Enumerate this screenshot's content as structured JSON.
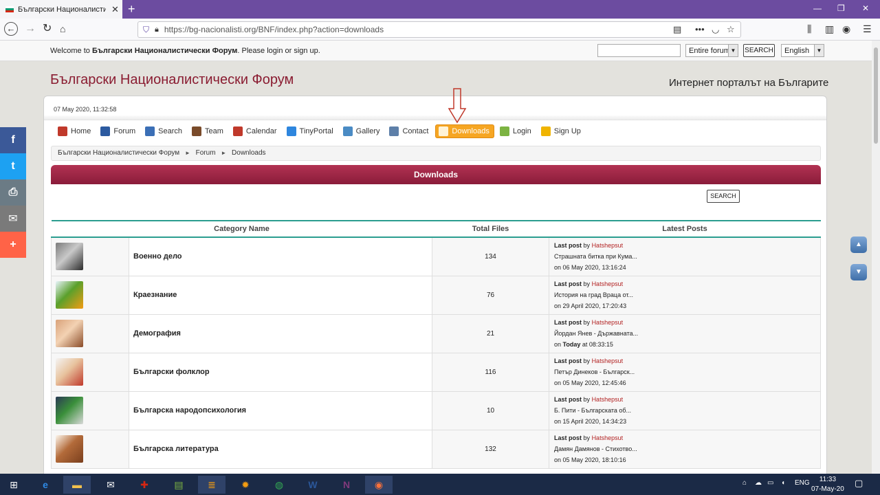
{
  "browser": {
    "tab_title": "Български Националисти...",
    "tab_close": "✕",
    "new_tab": "+",
    "url": "https://bg-nacionalisti.org/BNF/index.php?action=downloads",
    "window_controls": [
      "—",
      "❐",
      "✕"
    ]
  },
  "topbar": {
    "welcome_prefix": "Welcome to ",
    "forum_name": "Български Националистически Форум",
    "welcome_suffix": ". Please login or sign up.",
    "scope_select": "Entire forum",
    "search_button": "SEARCH",
    "language_select": "English"
  },
  "header": {
    "site_title": "Български Националистически Форум",
    "tagline": "Интернет порталът на Българите"
  },
  "datetime": "07 May 2020, 11:32:58",
  "menu": [
    {
      "label": "Home",
      "icon": "home-icon",
      "color": "#c0392b"
    },
    {
      "label": "Forum",
      "icon": "forum-icon",
      "color": "#2c5aa0"
    },
    {
      "label": "Search",
      "icon": "search-icon",
      "color": "#3b6fb6"
    },
    {
      "label": "Team",
      "icon": "team-icon",
      "color": "#7a4b2a"
    },
    {
      "label": "Calendar",
      "icon": "calendar-icon",
      "color": "#c0392b"
    },
    {
      "label": "TinyPortal",
      "icon": "tinyportal-icon",
      "color": "#2e86de"
    },
    {
      "label": "Gallery",
      "icon": "gallery-icon",
      "color": "#4a8bc4"
    },
    {
      "label": "Contact",
      "icon": "mail-icon",
      "color": "#5d7fa8"
    },
    {
      "label": "Downloads",
      "icon": "downloads-icon",
      "color": "#ffffff",
      "active": true
    },
    {
      "label": "Login",
      "icon": "login-icon",
      "color": "#7cb342"
    },
    {
      "label": "Sign Up",
      "icon": "signup-icon",
      "color": "#f0b400"
    }
  ],
  "breadcrumb": [
    "Български Националистически Форум",
    "Forum",
    "Downloads"
  ],
  "breadcrumb_sep": "►",
  "section_title": "Downloads",
  "search_button": "SEARCH",
  "table": {
    "headers": [
      "Category Name",
      "Total Files",
      "Latest Posts"
    ],
    "rows": [
      {
        "name": "Военно дело",
        "files": "134",
        "last_label": "Last post",
        "by": "by",
        "author": "Hatshepsut",
        "title": "Страшната битка при Кума...",
        "on": "on 06 May 2020, 13:16:24",
        "thumb": [
          "#7b7b7b",
          "#2b2b2b",
          "#c9c9c9"
        ]
      },
      {
        "name": "Краезнание",
        "files": "76",
        "last_label": "Last post",
        "by": "by",
        "author": "Hatshepsut",
        "title": "История на град Враца от...",
        "on": "on 29 April 2020, 17:20:43",
        "thumb": [
          "#e8f4fb",
          "#f39c12",
          "#5aa02c"
        ]
      },
      {
        "name": "Демография",
        "files": "21",
        "last_label": "Last post",
        "by": "by",
        "author": "Hatshepsut",
        "title": "Йордан Янев - Държавната...",
        "on_prefix": "on ",
        "on_bold": "Today",
        "on_suffix": " at 08:33:15",
        "thumb": [
          "#d9a27a",
          "#8a4b28",
          "#f3d2b3"
        ]
      },
      {
        "name": "Български фолклор",
        "files": "116",
        "last_label": "Last post",
        "by": "by",
        "author": "Hatshepsut",
        "title": "Петър Динеков - Българск...",
        "on": "on 05 May 2020, 12:45:46",
        "thumb": [
          "#f4f4f4",
          "#c0392b",
          "#e8c39e"
        ]
      },
      {
        "name": "Българска народопсихология",
        "files": "10",
        "last_label": "Last post",
        "by": "by",
        "author": "Hatshepsut",
        "title": "Б. Пити - Българската об...",
        "on": "on 15 April 2020, 14:34:23",
        "thumb": [
          "#2b3a55",
          "#d9d9d9",
          "#3a8f3a"
        ]
      },
      {
        "name": "Българска литература",
        "files": "132",
        "last_label": "Last post",
        "by": "by",
        "author": "Hatshepsut",
        "title": "Дамян Дамянов - Стихотво...",
        "on": "on 05 May 2020, 18:10:16",
        "thumb": [
          "#fdf6ec",
          "#7a3f1d",
          "#b36b3a"
        ]
      }
    ]
  },
  "social": [
    {
      "label": "f",
      "name": "facebook",
      "color": "#3b5998"
    },
    {
      "label": "t",
      "name": "twitter",
      "color": "#1da1f2"
    },
    {
      "label": "⎙",
      "name": "print",
      "color": "#6b7b85"
    },
    {
      "label": "✉",
      "name": "email",
      "color": "#7a7a7a"
    },
    {
      "label": "+",
      "name": "share",
      "color": "#ff6347"
    }
  ],
  "taskbar": {
    "lang": "ENG",
    "time": "11:33",
    "date": "07-May-20"
  }
}
